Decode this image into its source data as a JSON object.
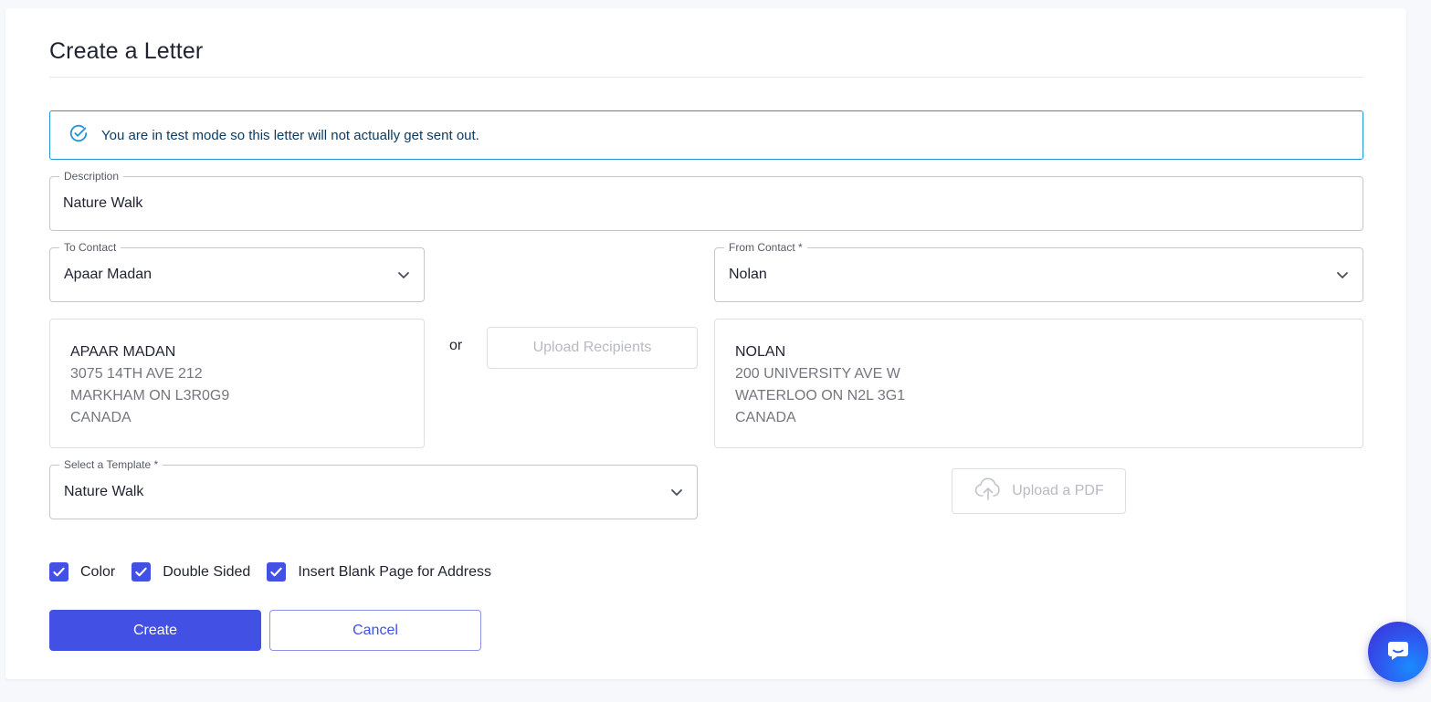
{
  "page": {
    "title": "Create a Letter"
  },
  "alert": {
    "text": "You are in test mode so this letter will not actually get sent out."
  },
  "description": {
    "label": "Description",
    "value": "Nature Walk"
  },
  "to_contact": {
    "label": "To Contact",
    "value": "Apaar Madan",
    "address_lines": [
      "APAAR MADAN",
      "3075 14TH AVE 212",
      "MARKHAM ON L3R0G9",
      "CANADA"
    ]
  },
  "from_contact": {
    "label": "From Contact *",
    "value": "Nolan",
    "address_lines": [
      "NOLAN",
      "200 UNIVERSITY AVE W",
      "WATERLOO ON N2L 3G1",
      "CANADA"
    ]
  },
  "or_text": "or",
  "upload_recipients_label": "Upload Recipients",
  "template": {
    "label": "Select a Template *",
    "value": "Nature Walk"
  },
  "upload_pdf_label": "Upload a PDF",
  "options": [
    {
      "label": "Color",
      "checked": true
    },
    {
      "label": "Double Sided",
      "checked": true
    },
    {
      "label": "Insert Blank Page for Address",
      "checked": true
    }
  ],
  "actions": {
    "create_label": "Create",
    "cancel_label": "Cancel"
  },
  "colors": {
    "accent": "#4250e4",
    "alert_border": "#2196d6",
    "alert_text": "#0d3c61"
  },
  "icons": {
    "alert": "check-circle-icon",
    "dropdown": "chevron-down-icon",
    "upload": "cloud-upload-icon",
    "checkbox": "check-icon",
    "chat": "chat-bubble-icon"
  }
}
